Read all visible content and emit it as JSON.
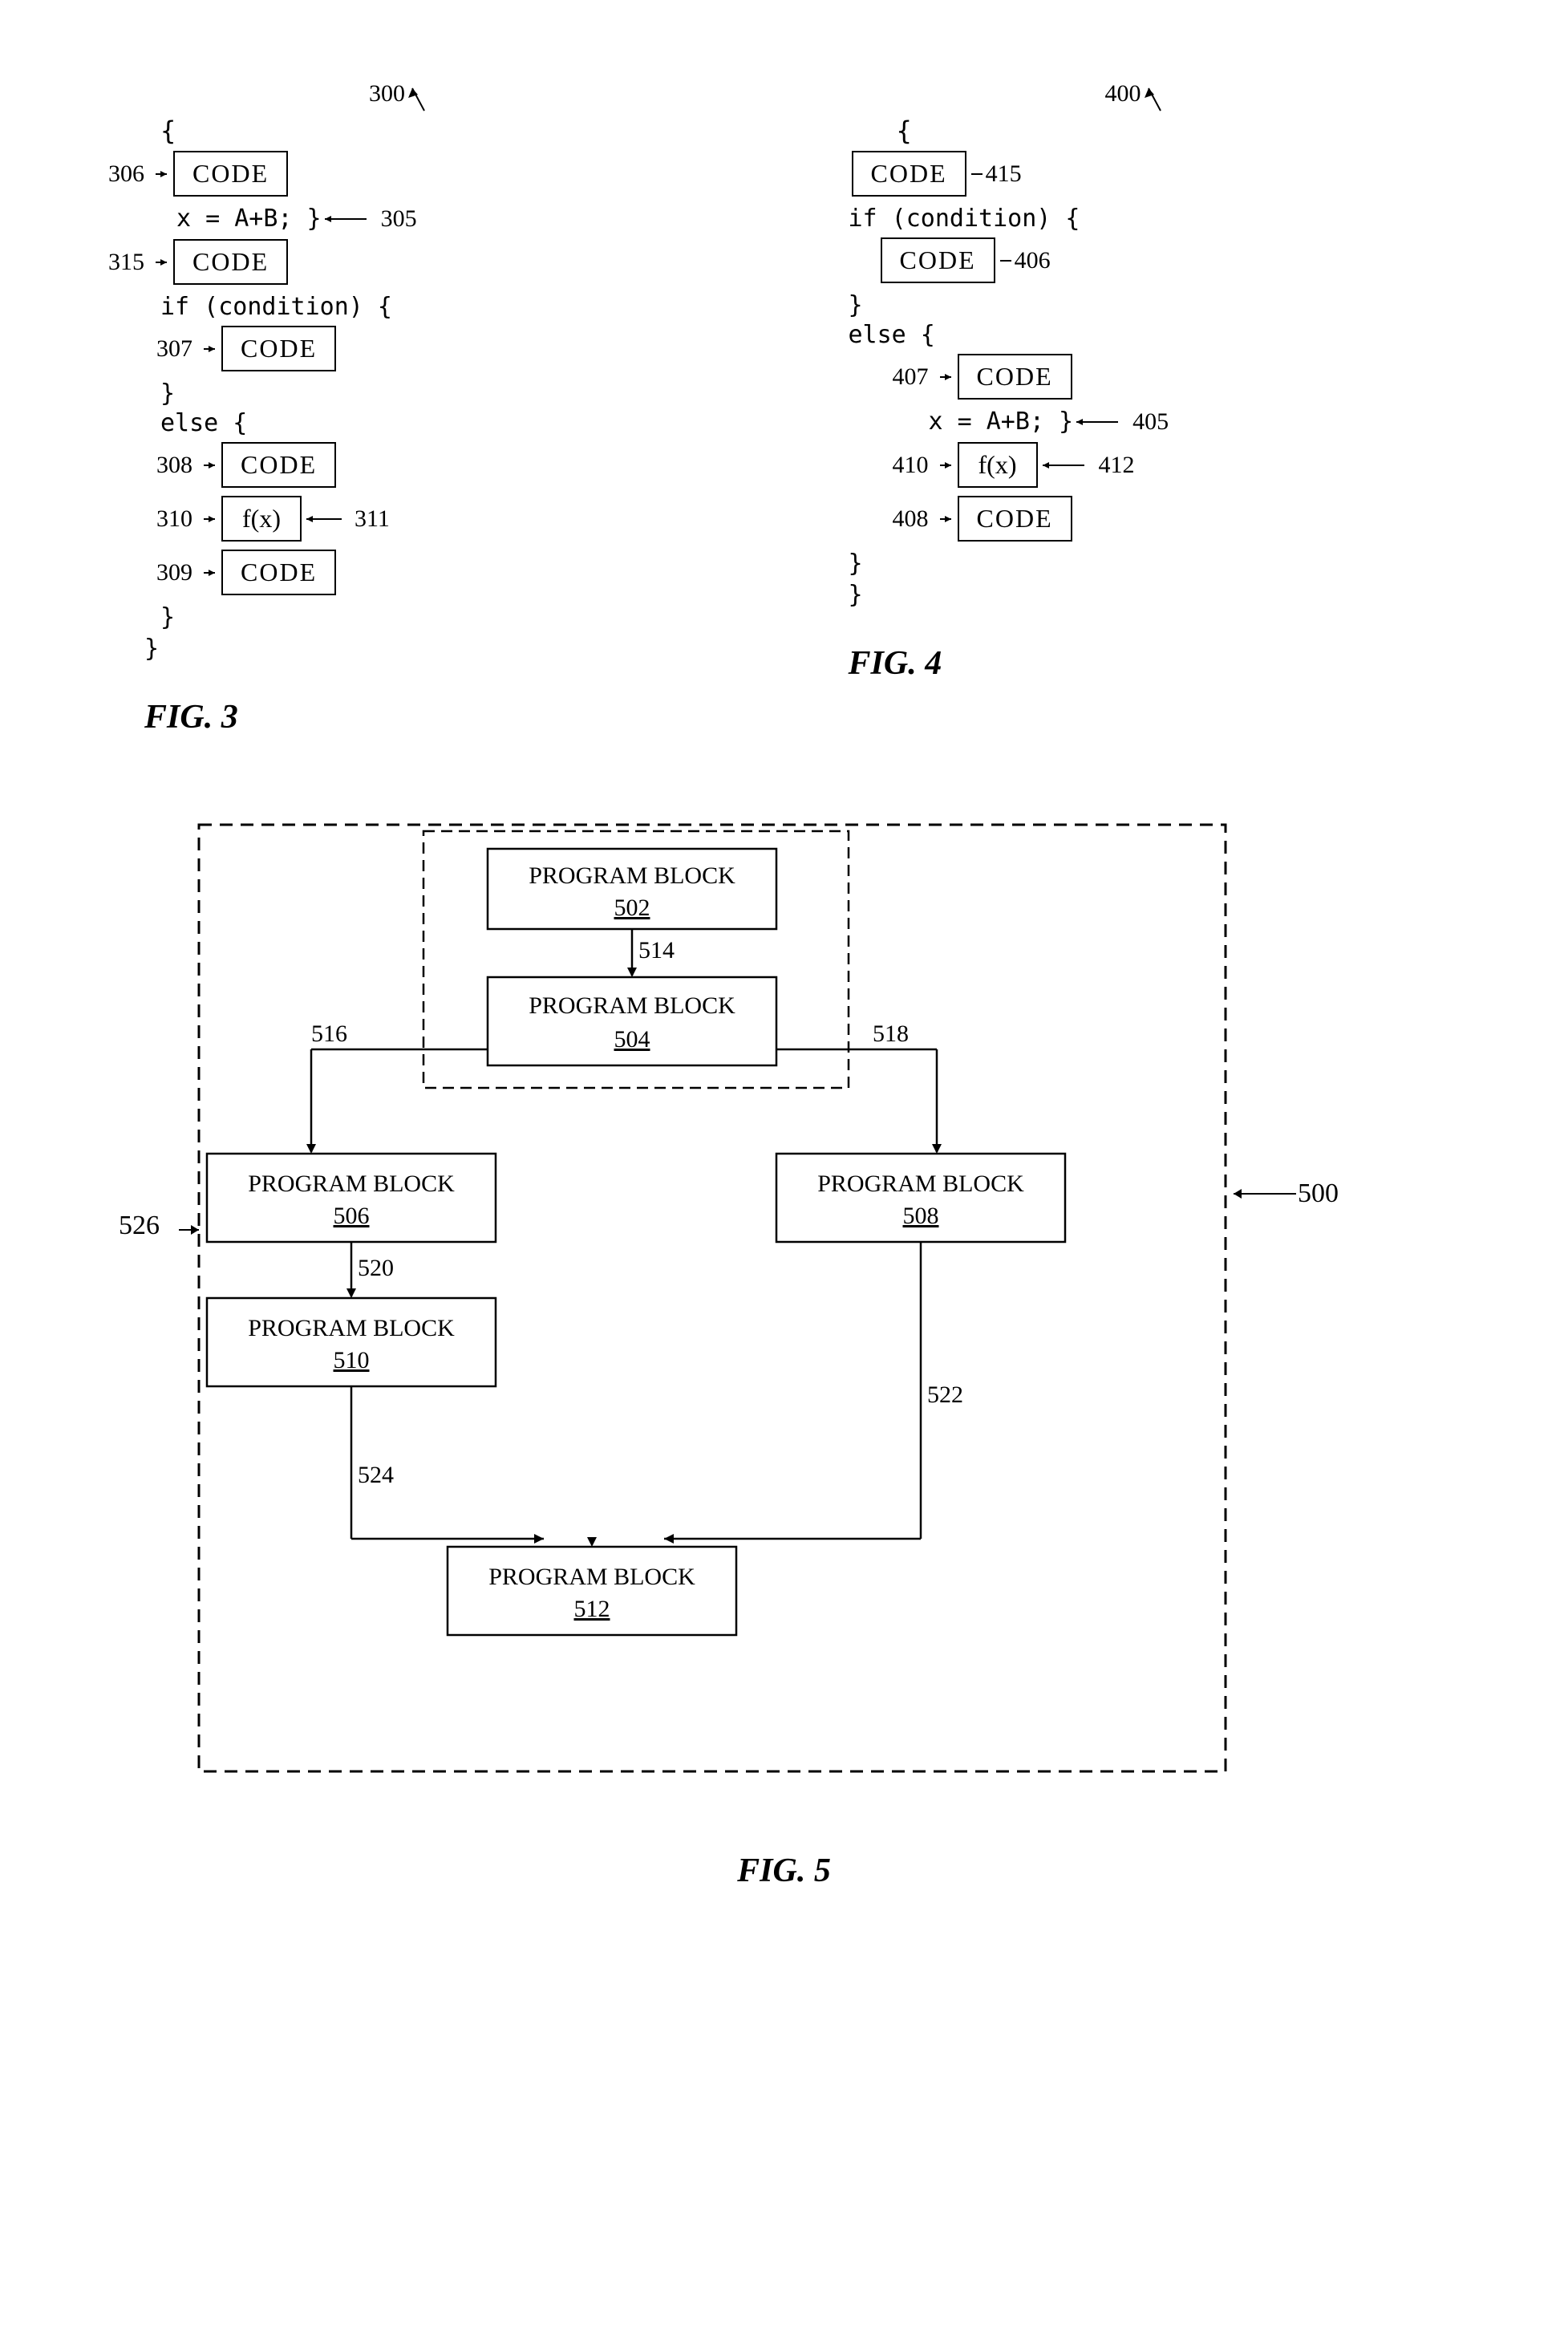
{
  "fig3": {
    "label": "FIG. 3",
    "ref_main": "300",
    "open_brace": "{",
    "close_brace": "}",
    "rows": [
      {
        "ref": "306",
        "type": "code",
        "text": "CODE"
      },
      {
        "ref": null,
        "type": "text",
        "text": "x = A+B; }",
        "ref_right": "305"
      },
      {
        "ref": "315",
        "type": "code",
        "text": "CODE"
      },
      {
        "ref": null,
        "type": "text",
        "text": "if (condition) {"
      },
      {
        "ref": "307",
        "type": "code",
        "text": "CODE",
        "indent": true
      },
      {
        "ref": null,
        "type": "text",
        "text": "}"
      },
      {
        "ref": null,
        "type": "text",
        "text": "else {"
      },
      {
        "ref": "308",
        "type": "code",
        "text": "CODE",
        "indent": true
      },
      {
        "ref": "310",
        "type": "fx",
        "text": "f(x)",
        "indent": true,
        "ref_right": "311"
      },
      {
        "ref": "309",
        "type": "code",
        "text": "CODE",
        "indent": true
      },
      {
        "ref": null,
        "type": "text",
        "text": "}"
      },
      {
        "ref": null,
        "type": "text",
        "text": "}"
      }
    ]
  },
  "fig4": {
    "label": "FIG. 4",
    "ref_main": "400",
    "open_brace": "{",
    "rows": [
      {
        "ref": null,
        "type": "code",
        "text": "CODE",
        "ref_right": "415"
      },
      {
        "ref": null,
        "type": "text",
        "text": "if (condition) {"
      },
      {
        "ref": null,
        "type": "code",
        "text": "CODE",
        "ref_right": "406",
        "indent": true
      },
      {
        "ref": null,
        "type": "text",
        "text": "}"
      },
      {
        "ref": null,
        "type": "text",
        "text": "else {"
      },
      {
        "ref": "407",
        "type": "code",
        "text": "CODE",
        "indent": true
      },
      {
        "ref": null,
        "type": "text",
        "text": "x = A+B; }",
        "ref_right": "405",
        "indent": true
      },
      {
        "ref": "410",
        "type": "fx",
        "text": "f(x)",
        "indent": true,
        "ref_right": "412"
      },
      {
        "ref": "408",
        "type": "code",
        "text": "CODE",
        "indent": true
      },
      {
        "ref": null,
        "type": "text",
        "text": "}"
      },
      {
        "ref": null,
        "type": "text",
        "text": "}"
      }
    ]
  },
  "fig5": {
    "label": "FIG. 5",
    "ref_main": "500",
    "blocks": [
      {
        "id": "502",
        "label": "PROGRAM BLOCK",
        "num": "502"
      },
      {
        "id": "504",
        "label": "PROGRAM BLOCK",
        "num": "504"
      },
      {
        "id": "506",
        "label": "PROGRAM BLOCK",
        "num": "506"
      },
      {
        "id": "508",
        "label": "PROGRAM BLOCK",
        "num": "508"
      },
      {
        "id": "510",
        "label": "PROGRAM BLOCK",
        "num": "510"
      },
      {
        "id": "512",
        "label": "PROGRAM BLOCK",
        "num": "512"
      }
    ],
    "arrows": {
      "514": "514",
      "516": "516",
      "518": "518",
      "520": "520",
      "522": "522",
      "524": "524",
      "526": "526"
    }
  }
}
